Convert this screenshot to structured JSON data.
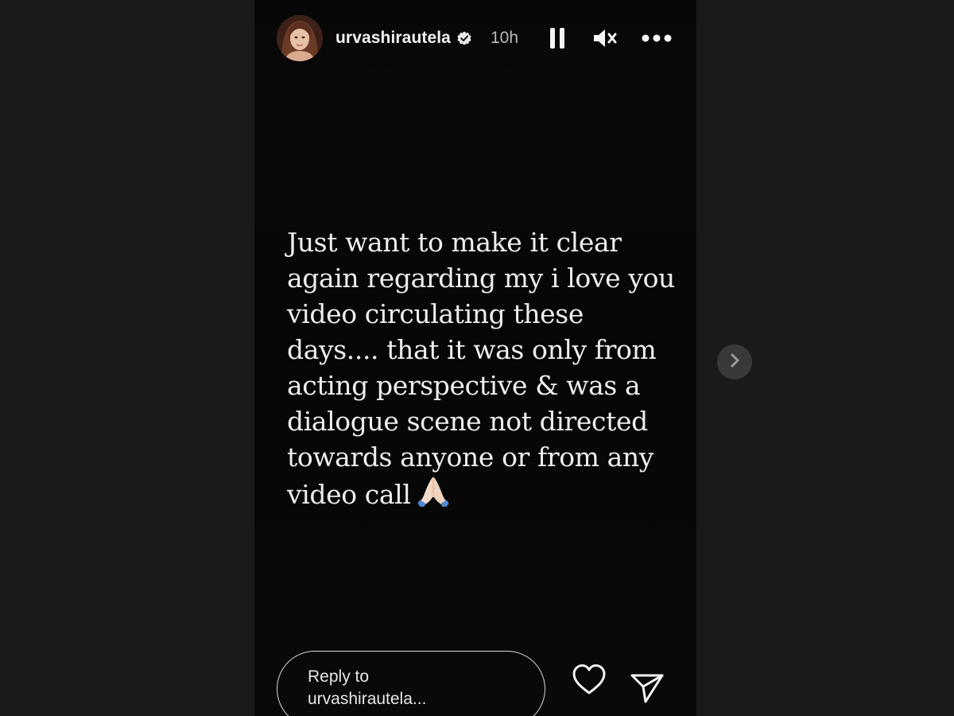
{
  "story": {
    "username": "urvashirautela",
    "time_ago": "10h",
    "verified": true,
    "text_lines": [
      "Just want to make it clear",
      "again regarding my i love you",
      "video circulating these",
      "days.... that it was only from",
      "acting perspective & was a",
      "dialogue scene not directed",
      "towards anyone or from any",
      "video call"
    ],
    "emoji": "folded-hands-emoji"
  },
  "controls": {
    "pause_icon": "pause-icon",
    "mute_icon": "muted-speaker-icon",
    "more_icon": "more-options-icon"
  },
  "footer": {
    "reply_line1": "Reply to",
    "reply_line2": "urvashirautela...",
    "like_icon": "heart-icon",
    "share_icon": "send-icon"
  },
  "navigation": {
    "next_icon": "chevron-right-icon"
  },
  "colors": {
    "page_bg": "#1b1a1a",
    "story_bg": "#080707",
    "text": "#ededed",
    "time": "#b9b9b9",
    "nav_button_bg": "#3a3939"
  }
}
